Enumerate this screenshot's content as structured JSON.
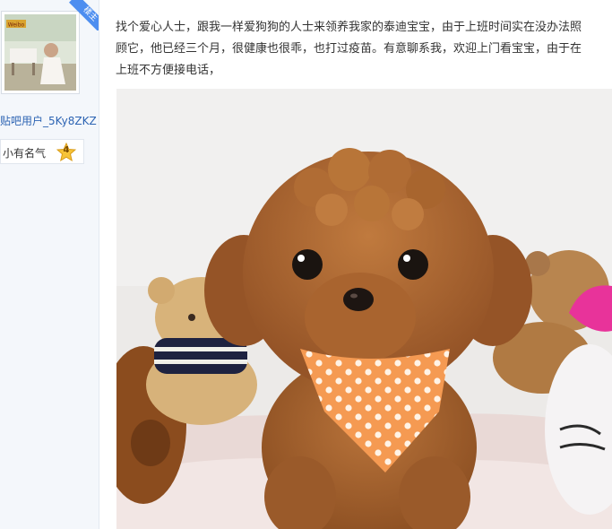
{
  "author": {
    "badge": "楼主",
    "avatar_caption": "Weibo",
    "username": "贴吧用户_5Ky8ZKZ",
    "level_label": "小有名气",
    "level": "4"
  },
  "post": {
    "lines": [
      "找个爱心人士，跟我一样爱狗狗的人士来领养我家的泰迪宝宝，由于上班时间实在没办法照",
      "顾它，他已经三个月，很健康也很乖，也打过疫苗。有意聊系我，欢迎上门看宝宝，由于在",
      "上班不方便接电话，"
    ]
  },
  "image": {
    "subject": "teddy-poodle-puppy-photo",
    "colors": {
      "fur": "#a8652e",
      "bandana": "#f59a52",
      "wall": "#eceae8"
    }
  }
}
